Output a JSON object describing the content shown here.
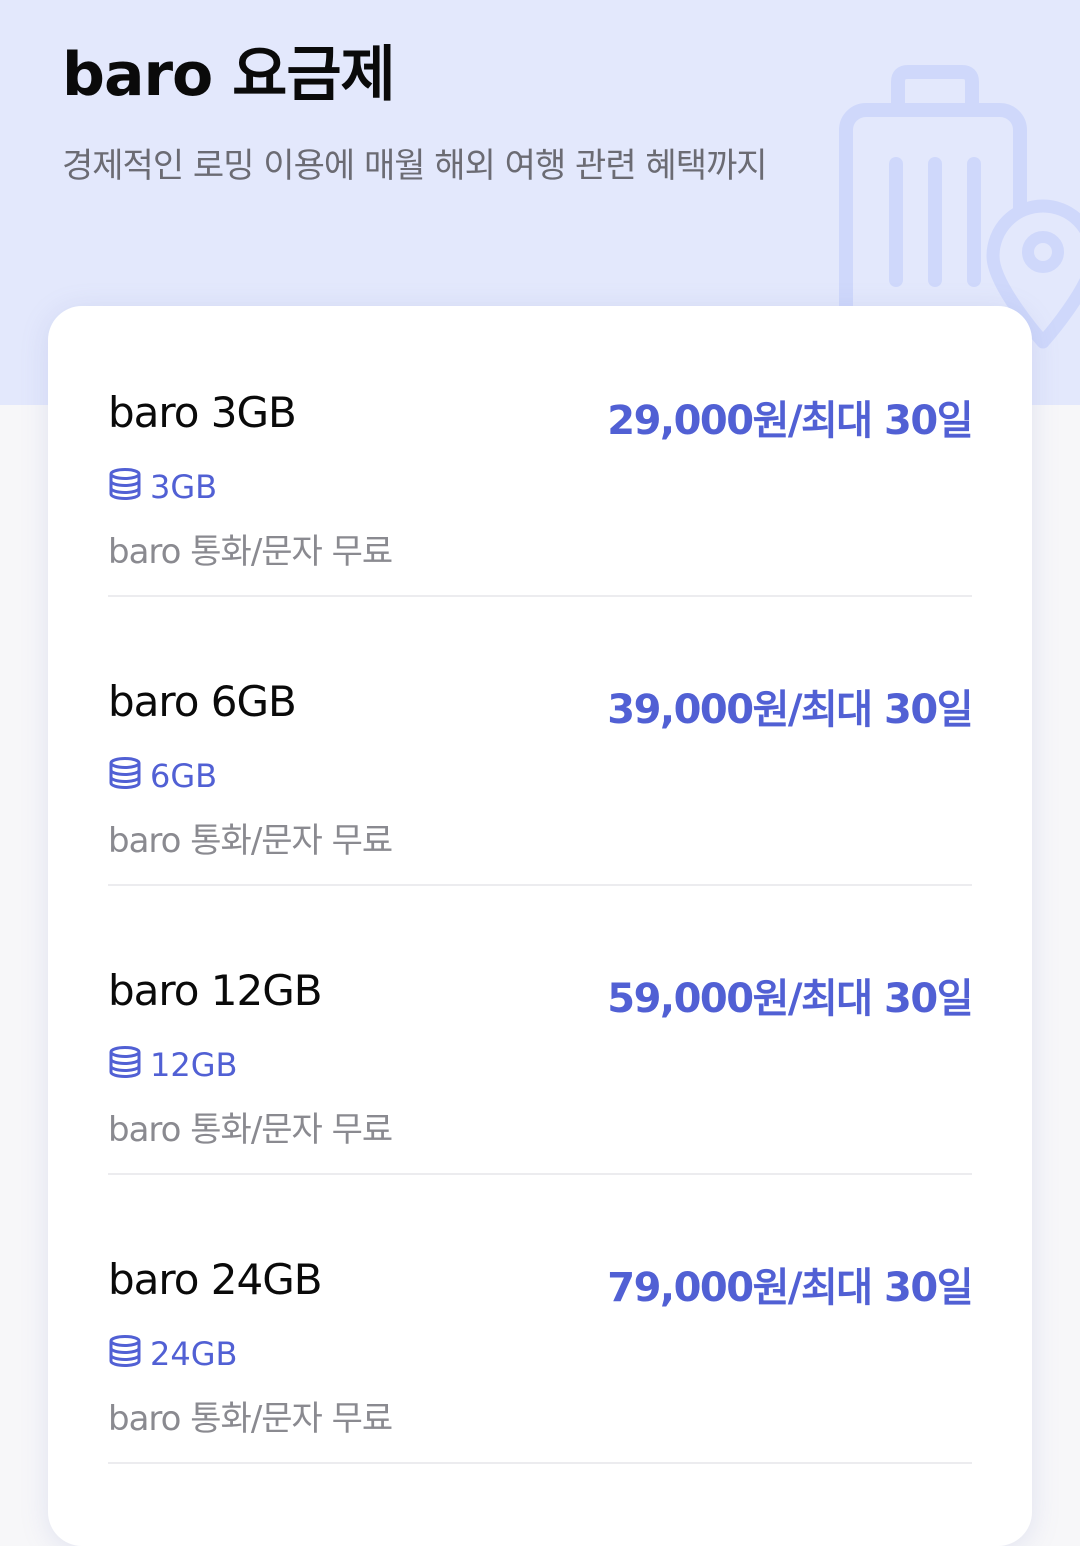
{
  "header": {
    "title": "baro 요금제",
    "subtitle": "경제적인 로밍 이용에 매월 해외 여행 관련 혜택까지",
    "background_color": "#e3e8fc",
    "decoration_icon": "luggage-location-icon"
  },
  "plans": [
    {
      "name": "baro 3GB",
      "price": "29,000원/최대 30일",
      "data": "3GB",
      "benefit": "baro 통화/문자 무료"
    },
    {
      "name": "baro 6GB",
      "price": "39,000원/최대 30일",
      "data": "6GB",
      "benefit": "baro 통화/문자 무료"
    },
    {
      "name": "baro 12GB",
      "price": "59,000원/최대 30일",
      "data": "12GB",
      "benefit": "baro 통화/문자 무료"
    },
    {
      "name": "baro 24GB",
      "price": "79,000원/최대 30일",
      "data": "24GB",
      "benefit": "baro 통화/문자 무료"
    }
  ],
  "icons": {
    "data": "database-icon"
  },
  "colors": {
    "accent": "#5160d4",
    "text": "#0a0a0a",
    "muted": "#8a8a90"
  }
}
